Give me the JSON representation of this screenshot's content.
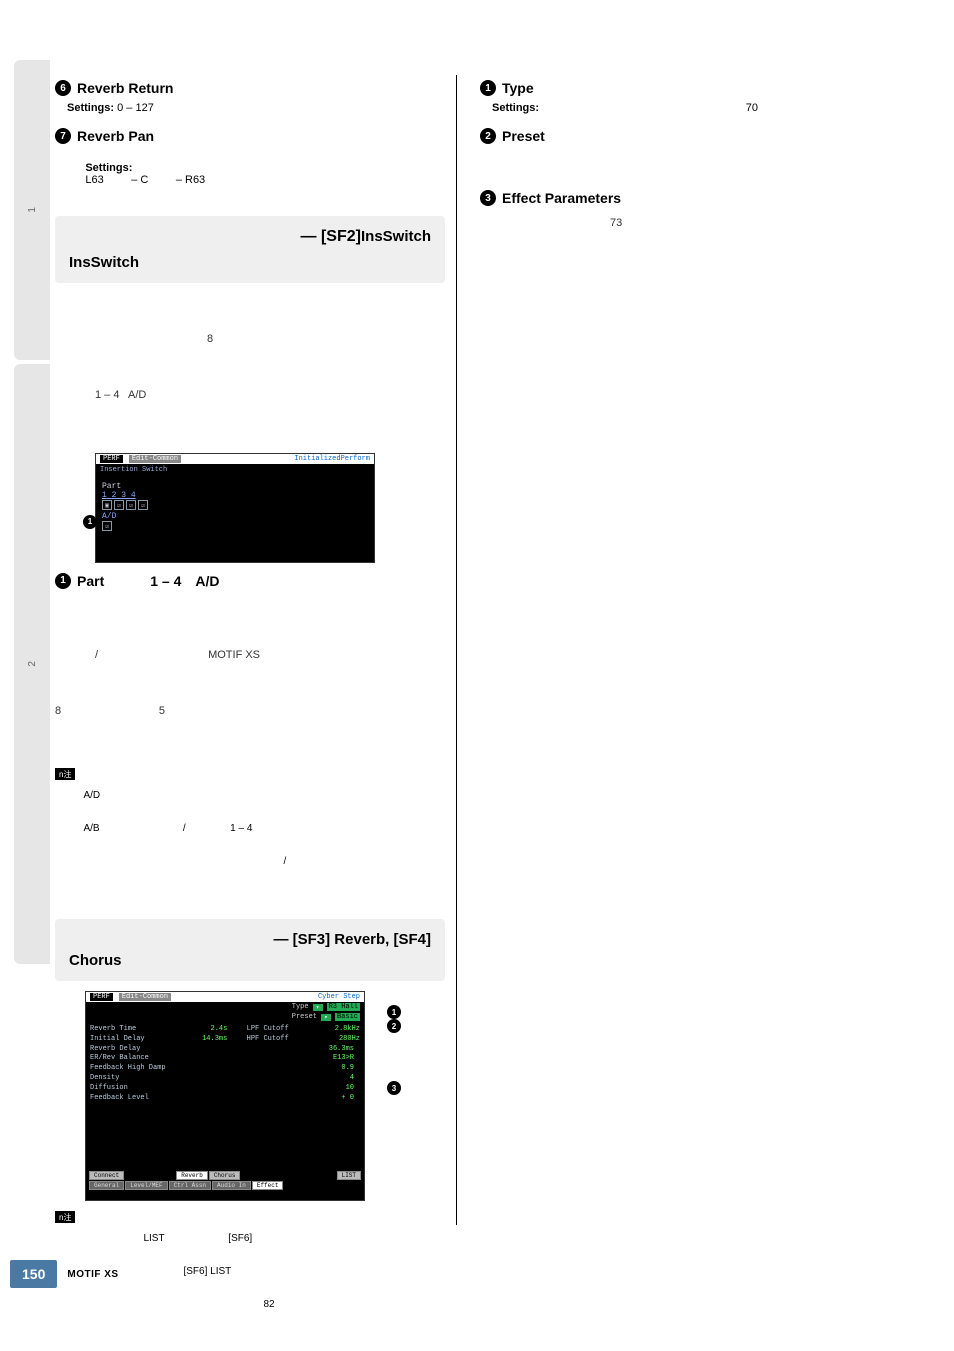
{
  "sidebar": {
    "tab1": "1",
    "tab2": "2"
  },
  "left": {
    "s6": {
      "num": "6",
      "title": "Reverb Return",
      "settings_label": "Settings:",
      "settings_val": "0 – 127"
    },
    "s7": {
      "num": "7",
      "title": "Reverb Pan",
      "settings_label": "Settings:",
      "settings_val": "L63         – C         – R63"
    },
    "box1": {
      "right": "— [SF2]",
      "left": "InsSwitch",
      "desc_a": "8",
      "desc_b": "1 – 4   A/D"
    },
    "ss1": {
      "top_perf": "PERF",
      "top_edit": "Edit-Common",
      "top_init": "InitializedPerform",
      "sub": "Insertion Switch",
      "part_label": "Part",
      "cols": [
        "1",
        "2",
        "3",
        "4"
      ],
      "ad": "A/D"
    },
    "callout1": "1",
    "part_heading": {
      "num": "1",
      "label": "Part",
      "mid": "1 – 4",
      "right": "A/D"
    },
    "part_body_1": "/                                    MOTIF XS",
    "part_body_2": "8                                5",
    "note1": {
      "tag": "n注",
      "l1": "A/D",
      "l2": "A/B                              /                1 – 4",
      "l3": "/"
    },
    "box2": {
      "right": "— [SF3] Reverb, [SF4]",
      "left": "Chorus"
    },
    "ss2": {
      "top_perf": "PERF",
      "top_edit": "Edit-Common",
      "top_right": "Cyber Step",
      "type_lbl": "Type",
      "type_val": "R3 Hall",
      "preset_lbl": "Preset",
      "preset_val": "Basic",
      "rows": [
        {
          "l": "Reverb Time",
          "m": "2.4s",
          "r": "LPF Cutoff",
          "rv": "2.8kHz"
        },
        {
          "l": "Initial Delay",
          "m": "14.3ms",
          "r": "HPF Cutoff",
          "rv": "280Hz"
        },
        {
          "l": "Reverb Delay",
          "m": "36.3ms",
          "r": "",
          "rv": ""
        },
        {
          "l": "ER/Rev Balance",
          "m": "E13>R",
          "r": "",
          "rv": ""
        },
        {
          "l": "Feedback High Damp",
          "m": "0.9",
          "r": "",
          "rv": ""
        },
        {
          "l": "Density",
          "m": "4",
          "r": "",
          "rv": ""
        },
        {
          "l": "Diffusion",
          "m": "10",
          "r": "",
          "rv": ""
        },
        {
          "l": "Feedback Level",
          "m": "+ 0",
          "r": "",
          "rv": ""
        }
      ],
      "bot_r1": [
        "Connect",
        "Reverb",
        "Chorus"
      ],
      "bot_r1_right": "LIST",
      "bot_r2": [
        "General",
        "Level/MEF",
        "Ctrl Assn",
        "Audio In",
        "Effect"
      ]
    },
    "callouts_ss2": {
      "c1": "1",
      "c2": "2",
      "c3": "3"
    },
    "note2": {
      "tag": "n注",
      "l1": "LIST                       [SF6]",
      "l2": "[SF6] LIST",
      "l3": "82"
    }
  },
  "right": {
    "s1": {
      "num": "1",
      "title": "Type",
      "settings_label": "Settings:",
      "settings_val": "70"
    },
    "s2": {
      "num": "2",
      "title": "Preset"
    },
    "s3": {
      "num": "3",
      "title": "Effect Parameters",
      "line": "73"
    }
  },
  "footer": {
    "page": "150",
    "product": "MOTIF XS"
  }
}
